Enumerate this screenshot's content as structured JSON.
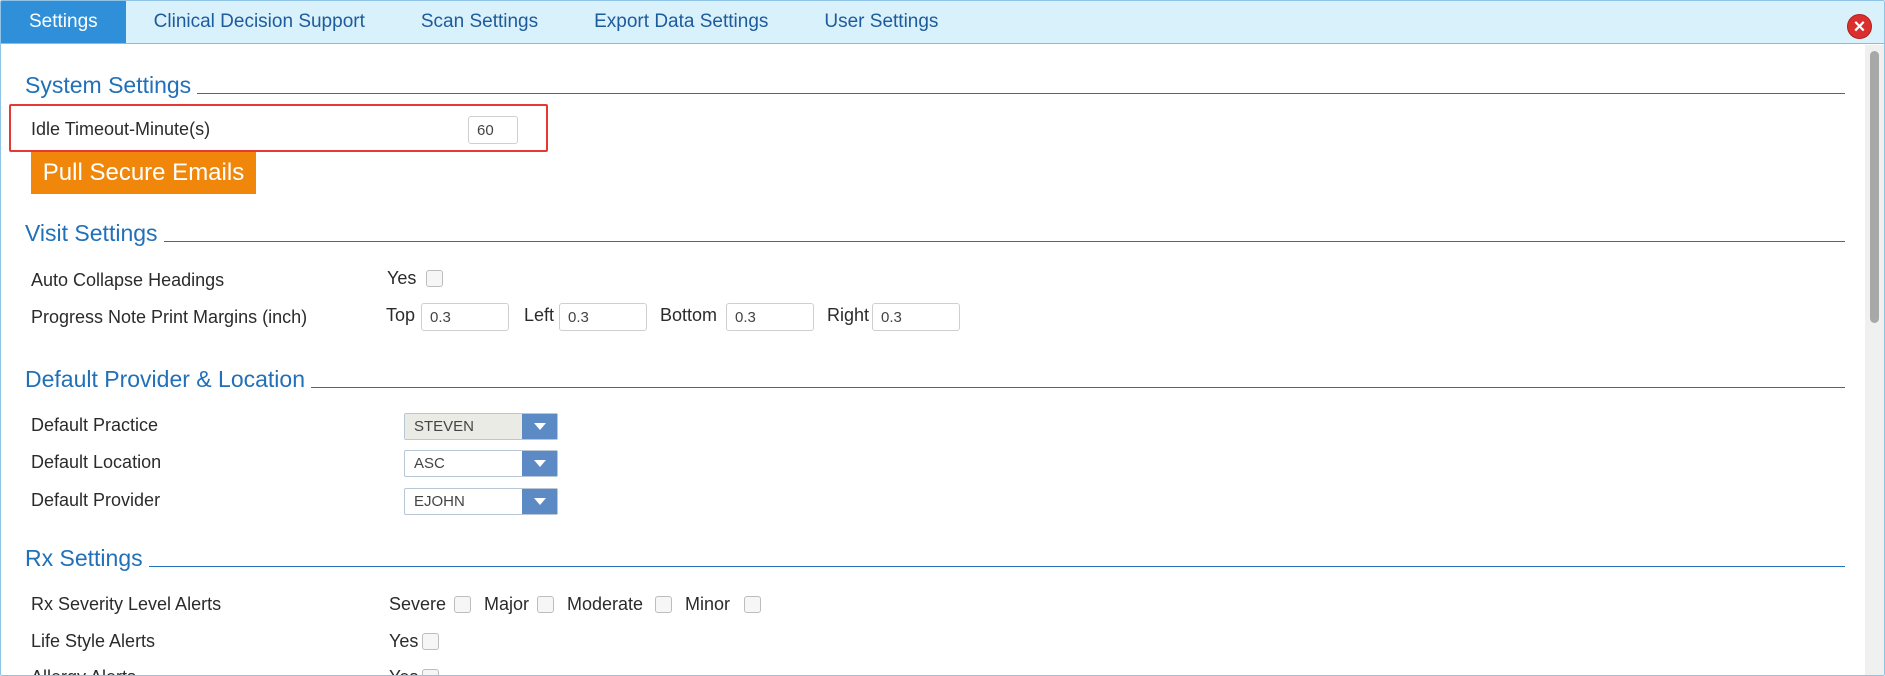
{
  "tabs": [
    {
      "label": "Settings",
      "active": true
    },
    {
      "label": "Clinical Decision Support"
    },
    {
      "label": "Scan Settings"
    },
    {
      "label": "Export Data Settings"
    },
    {
      "label": "User Settings"
    }
  ],
  "close_icon": "close-icon",
  "system_settings": {
    "title": "System Settings",
    "idle_timeout_label": "Idle Timeout-Minute(s)",
    "idle_timeout_value": "60",
    "pull_emails_label": "Pull Secure Emails"
  },
  "visit_settings": {
    "title": "Visit Settings",
    "auto_collapse_label": "Auto Collapse Headings",
    "auto_collapse_option": "Yes",
    "margins_label": "Progress Note Print Margins (inch)",
    "margins": {
      "top_label": "Top",
      "top_value": "0.3",
      "left_label": "Left",
      "left_value": "0.3",
      "bottom_label": "Bottom",
      "bottom_value": "0.3",
      "right_label": "Right",
      "right_value": "0.3"
    }
  },
  "default_provider": {
    "title": "Default Provider & Location",
    "practice_label": "Default Practice",
    "practice_value": "STEVEN",
    "location_label": "Default Location",
    "location_value": "ASC",
    "provider_label": "Default Provider",
    "provider_value": "EJOHN"
  },
  "rx_settings": {
    "title": "Rx Settings",
    "severity_label": "Rx Severity Level Alerts",
    "severity_options": [
      "Severe",
      "Major",
      "Moderate",
      "Minor"
    ],
    "lifestyle_label": "Life Style Alerts",
    "lifestyle_option": "Yes",
    "allergy_label": "Allergy Alerts",
    "allergy_option": "Yes"
  },
  "colors": {
    "accent": "#2f8fd8",
    "heading": "#2170b8",
    "button_orange": "#f0870b",
    "highlight_red": "#e53935"
  }
}
